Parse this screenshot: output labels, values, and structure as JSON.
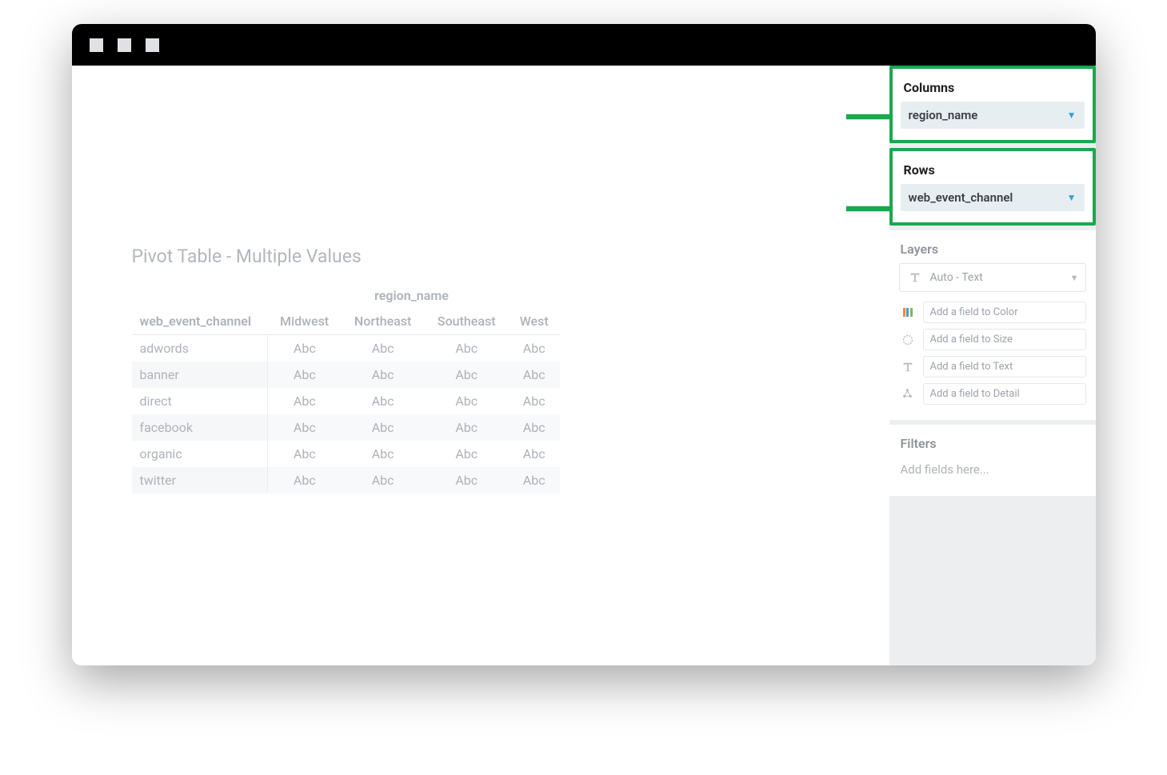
{
  "title": "Pivot Table - Multiple Values",
  "pivot": {
    "column_field_label": "region_name",
    "row_field_label": "web_event_channel",
    "columns": [
      "Midwest",
      "Northeast",
      "Southeast",
      "West"
    ],
    "rows": [
      "adwords",
      "banner",
      "direct",
      "facebook",
      "organic",
      "twitter"
    ],
    "cell_value": "Abc"
  },
  "panel": {
    "columns": {
      "label": "Columns",
      "value": "region_name"
    },
    "rows": {
      "label": "Rows",
      "value": "web_event_channel"
    },
    "layers": {
      "label": "Layers",
      "type_value": "Auto - Text",
      "fields": {
        "color": "Add a field to Color",
        "size": "Add a field to Size",
        "text": "Add a field to Text",
        "detail": "Add a field to Detail"
      }
    },
    "filters": {
      "label": "Filters",
      "placeholder": "Add fields here..."
    }
  }
}
